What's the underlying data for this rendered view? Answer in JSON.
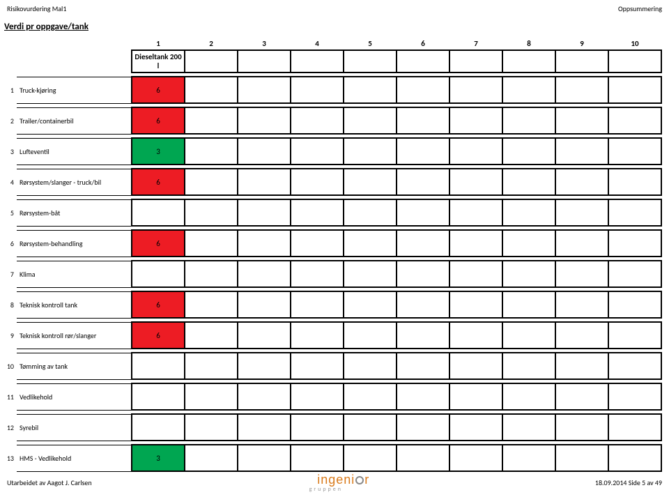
{
  "header": {
    "left": "Risikovurdering Mal1",
    "right": "Oppsummering"
  },
  "title": "Verdi pr oppgave/tank",
  "columns": {
    "nums": [
      "1",
      "2",
      "3",
      "4",
      "5",
      "6",
      "7",
      "8",
      "9",
      "10"
    ],
    "subheads": [
      "Dieseltank 200 l",
      "",
      "",
      "",
      "",
      "",
      "",
      "",
      "",
      ""
    ]
  },
  "rows": [
    {
      "n": "1",
      "label": "Truck-kjøring",
      "vals": [
        "6",
        "",
        "",
        "",
        "",
        "",
        "",
        "",
        "",
        ""
      ],
      "cls": [
        "red",
        "",
        "",
        "",
        "",
        "",
        "",
        "",
        "",
        ""
      ]
    },
    {
      "n": "2",
      "label": "Trailer/containerbil",
      "vals": [
        "6",
        "",
        "",
        "",
        "",
        "",
        "",
        "",
        "",
        ""
      ],
      "cls": [
        "red",
        "",
        "",
        "",
        "",
        "",
        "",
        "",
        "",
        ""
      ]
    },
    {
      "n": "3",
      "label": "Lufteventil",
      "vals": [
        "3",
        "",
        "",
        "",
        "",
        "",
        "",
        "",
        "",
        ""
      ],
      "cls": [
        "green",
        "",
        "",
        "",
        "",
        "",
        "",
        "",
        "",
        ""
      ]
    },
    {
      "n": "4",
      "label": "Rørsystem/slanger - truck/bil",
      "vals": [
        "6",
        "",
        "",
        "",
        "",
        "",
        "",
        "",
        "",
        ""
      ],
      "cls": [
        "red",
        "",
        "",
        "",
        "",
        "",
        "",
        "",
        "",
        ""
      ]
    },
    {
      "n": "5",
      "label": "Rørsystem-båt",
      "vals": [
        "",
        "",
        "",
        "",
        "",
        "",
        "",
        "",
        "",
        ""
      ],
      "cls": [
        "",
        "",
        "",
        "",
        "",
        "",
        "",
        "",
        "",
        ""
      ]
    },
    {
      "n": "6",
      "label": "Rørsystem-behandling",
      "vals": [
        "6",
        "",
        "",
        "",
        "",
        "",
        "",
        "",
        "",
        ""
      ],
      "cls": [
        "red",
        "",
        "",
        "",
        "",
        "",
        "",
        "",
        "",
        ""
      ]
    },
    {
      "n": "7",
      "label": "Klima",
      "vals": [
        "",
        "",
        "",
        "",
        "",
        "",
        "",
        "",
        "",
        ""
      ],
      "cls": [
        "",
        "",
        "",
        "",
        "",
        "",
        "",
        "",
        "",
        ""
      ]
    },
    {
      "n": "8",
      "label": "Teknisk kontroll tank",
      "vals": [
        "6",
        "",
        "",
        "",
        "",
        "",
        "",
        "",
        "",
        ""
      ],
      "cls": [
        "red",
        "",
        "",
        "",
        "",
        "",
        "",
        "",
        "",
        ""
      ]
    },
    {
      "n": "9",
      "label": "Teknisk kontroll rør/slanger",
      "vals": [
        "6",
        "",
        "",
        "",
        "",
        "",
        "",
        "",
        "",
        ""
      ],
      "cls": [
        "red",
        "",
        "",
        "",
        "",
        "",
        "",
        "",
        "",
        ""
      ]
    },
    {
      "n": "10",
      "label": "Tømming av tank",
      "vals": [
        "",
        "",
        "",
        "",
        "",
        "",
        "",
        "",
        "",
        ""
      ],
      "cls": [
        "",
        "",
        "",
        "",
        "",
        "",
        "",
        "",
        "",
        ""
      ]
    },
    {
      "n": "11",
      "label": "Vedlikehold",
      "vals": [
        "",
        "",
        "",
        "",
        "",
        "",
        "",
        "",
        "",
        ""
      ],
      "cls": [
        "",
        "",
        "",
        "",
        "",
        "",
        "",
        "",
        "",
        ""
      ]
    },
    {
      "n": "12",
      "label": "Syrebil",
      "vals": [
        "",
        "",
        "",
        "",
        "",
        "",
        "",
        "",
        "",
        ""
      ],
      "cls": [
        "",
        "",
        "",
        "",
        "",
        "",
        "",
        "",
        "",
        ""
      ]
    },
    {
      "n": "13",
      "label": "HMS - Vedlikehold",
      "vals": [
        "3",
        "",
        "",
        "",
        "",
        "",
        "",
        "",
        "",
        ""
      ],
      "cls": [
        "green",
        "",
        "",
        "",
        "",
        "",
        "",
        "",
        "",
        ""
      ]
    }
  ],
  "footer": {
    "left": "Utarbeidet av Aagot J. Carlsen",
    "right": "18.09.2014 Side 5 av 49",
    "logo_text": "ingeni",
    "logo_text2": "r",
    "logo_sub": "gruppen"
  },
  "chart_data": {
    "type": "table",
    "title": "Verdi pr oppgave/tank",
    "columns": [
      "Dieseltank 200 l",
      "",
      "",
      "",
      "",
      "",
      "",
      "",
      "",
      ""
    ],
    "rows": [
      {
        "label": "Truck-kjøring",
        "values": [
          6,
          null,
          null,
          null,
          null,
          null,
          null,
          null,
          null,
          null
        ]
      },
      {
        "label": "Trailer/containerbil",
        "values": [
          6,
          null,
          null,
          null,
          null,
          null,
          null,
          null,
          null,
          null
        ]
      },
      {
        "label": "Lufteventil",
        "values": [
          3,
          null,
          null,
          null,
          null,
          null,
          null,
          null,
          null,
          null
        ]
      },
      {
        "label": "Rørsystem/slanger - truck/bil",
        "values": [
          6,
          null,
          null,
          null,
          null,
          null,
          null,
          null,
          null,
          null
        ]
      },
      {
        "label": "Rørsystem-båt",
        "values": [
          null,
          null,
          null,
          null,
          null,
          null,
          null,
          null,
          null,
          null
        ]
      },
      {
        "label": "Rørsystem-behandling",
        "values": [
          6,
          null,
          null,
          null,
          null,
          null,
          null,
          null,
          null,
          null
        ]
      },
      {
        "label": "Klima",
        "values": [
          null,
          null,
          null,
          null,
          null,
          null,
          null,
          null,
          null,
          null
        ]
      },
      {
        "label": "Teknisk kontroll tank",
        "values": [
          6,
          null,
          null,
          null,
          null,
          null,
          null,
          null,
          null,
          null
        ]
      },
      {
        "label": "Teknisk kontroll rør/slanger",
        "values": [
          6,
          null,
          null,
          null,
          null,
          null,
          null,
          null,
          null,
          null
        ]
      },
      {
        "label": "Tømming av tank",
        "values": [
          null,
          null,
          null,
          null,
          null,
          null,
          null,
          null,
          null,
          null
        ]
      },
      {
        "label": "Vedlikehold",
        "values": [
          null,
          null,
          null,
          null,
          null,
          null,
          null,
          null,
          null,
          null
        ]
      },
      {
        "label": "Syrebil",
        "values": [
          null,
          null,
          null,
          null,
          null,
          null,
          null,
          null,
          null,
          null
        ]
      },
      {
        "label": "HMS - Vedlikehold",
        "values": [
          3,
          null,
          null,
          null,
          null,
          null,
          null,
          null,
          null,
          null
        ]
      }
    ]
  }
}
